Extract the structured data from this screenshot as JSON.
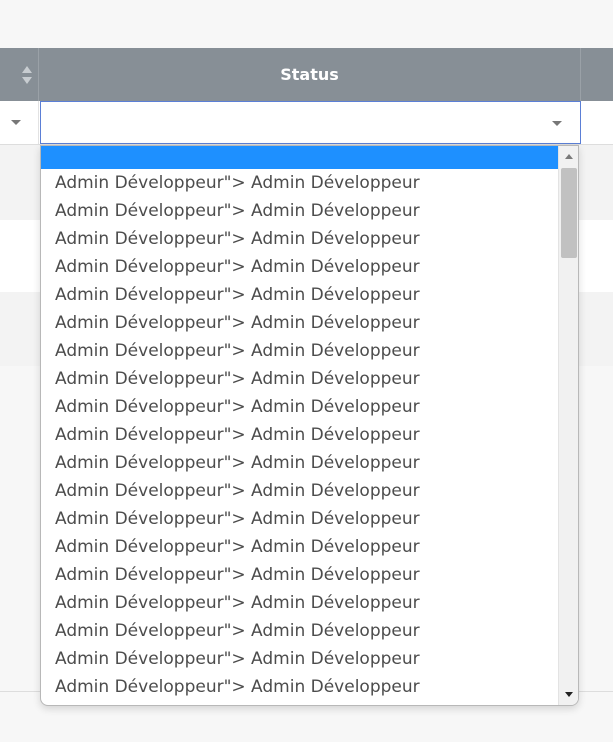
{
  "header": {
    "status_label": "Status"
  },
  "filters": {
    "left_filter_value": "",
    "status_filter_value": ""
  },
  "dropdown": {
    "selected_option": "",
    "options": [
      "",
      "Admin Développeur\"> Admin Développeur",
      "Admin Développeur\"> Admin Développeur",
      "Admin Développeur\"> Admin Développeur",
      "Admin Développeur\"> Admin Développeur",
      "Admin Développeur\"> Admin Développeur",
      "Admin Développeur\"> Admin Développeur",
      "Admin Développeur\"> Admin Développeur",
      "Admin Développeur\"> Admin Développeur",
      "Admin Développeur\"> Admin Développeur",
      "Admin Développeur\"> Admin Développeur",
      "Admin Développeur\"> Admin Développeur",
      "Admin Développeur\"> Admin Développeur",
      "Admin Développeur\"> Admin Développeur",
      "Admin Développeur\"> Admin Développeur",
      "Admin Développeur\"> Admin Développeur",
      "Admin Développeur\"> Admin Développeur",
      "Admin Développeur\"> Admin Développeur",
      "Admin Développeur\"> Admin Développeur",
      "Admin Développeur\"> Admin Développeur"
    ]
  },
  "icons": {
    "sort": "sort-icon",
    "left_dropdown": "chevron-down-icon",
    "status_dropdown": "chevron-down-icon",
    "scroll_up": "chevron-up-icon",
    "scroll_down": "chevron-down-icon"
  },
  "colors": {
    "header_background": "#878f96",
    "selected_option_background": "#1e90ff",
    "focus_border": "#5b7fd6"
  }
}
